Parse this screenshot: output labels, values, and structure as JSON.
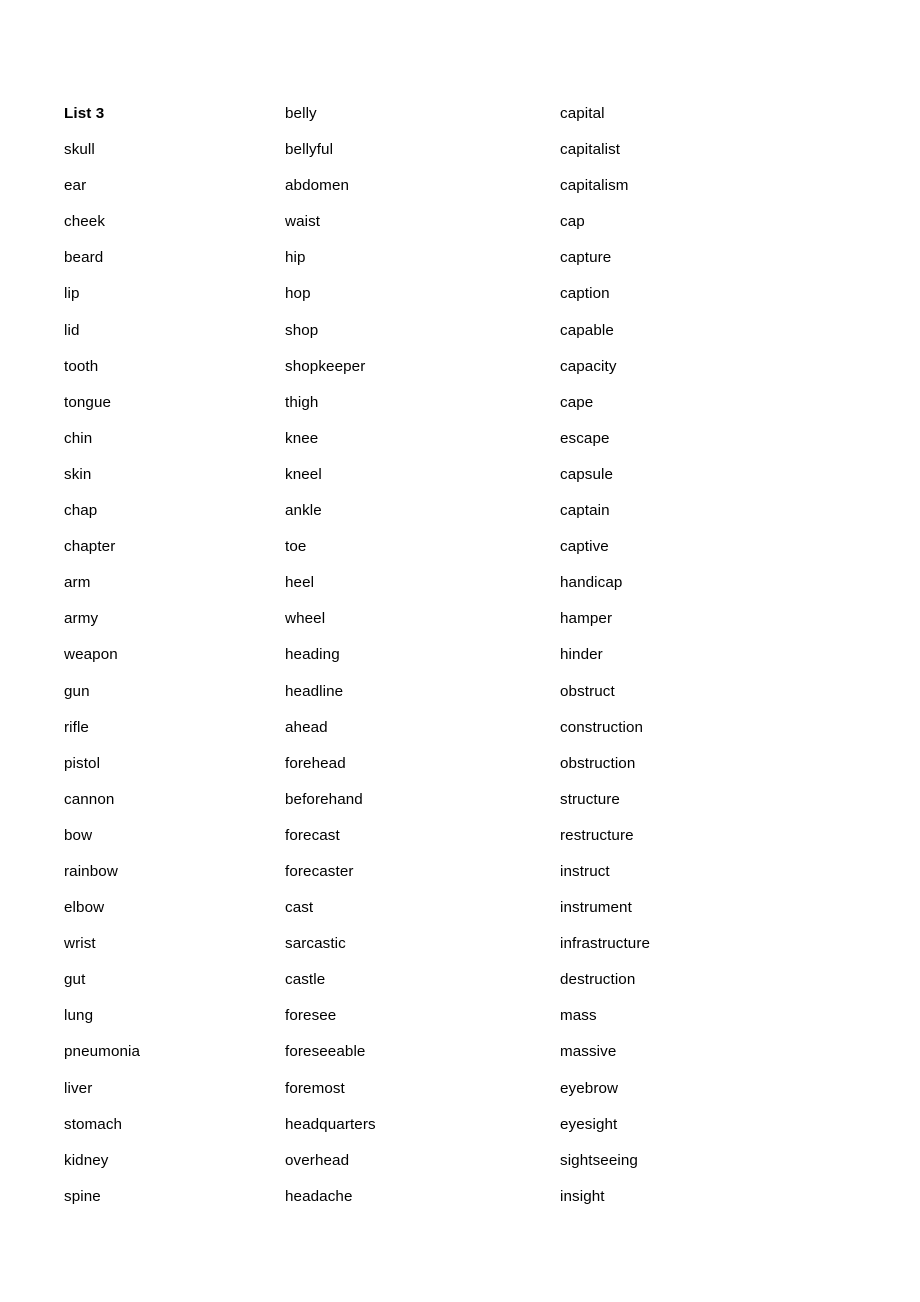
{
  "document": {
    "heading": "List 3",
    "columns": [
      {
        "name": "column-1",
        "words": [
          "skull",
          "ear",
          "cheek",
          "beard",
          "lip",
          "lid",
          "tooth",
          "tongue",
          "chin",
          "skin",
          "chap",
          "chapter",
          "arm",
          "army",
          "weapon",
          "gun",
          "rifle",
          "pistol",
          "cannon",
          "bow",
          "rainbow",
          "elbow",
          "wrist",
          "gut",
          "lung",
          "pneumonia",
          "liver",
          "stomach",
          "kidney",
          "spine"
        ]
      },
      {
        "name": "column-2",
        "words": [
          "belly",
          "bellyful",
          "abdomen",
          "waist",
          "hip",
          "hop",
          "shop",
          "shopkeeper",
          "thigh",
          "knee",
          "kneel",
          "ankle",
          "toe",
          "heel",
          "wheel",
          "heading",
          "headline",
          "ahead",
          "forehead",
          "beforehand",
          "forecast",
          "forecaster",
          "cast",
          "sarcastic",
          "castle",
          "foresee",
          "foreseeable",
          "foremost",
          "headquarters",
          "overhead",
          "headache"
        ]
      },
      {
        "name": "column-3",
        "words": [
          "capital",
          "capitalist",
          "capitalism",
          "cap",
          "capture",
          "caption",
          "capable",
          "capacity",
          "cape",
          "escape",
          "capsule",
          "captain",
          "captive",
          "handicap",
          "hamper",
          "hinder",
          "obstruct",
          "construction",
          "obstruction",
          "structure",
          "restructure",
          "instruct",
          "instrument",
          "infrastructure",
          "destruction",
          "mass",
          "massive",
          "eyebrow",
          "eyesight",
          "sightseeing",
          "insight"
        ]
      }
    ],
    "style": {
      "text_color": "#000000",
      "background_color": "#ffffff"
    }
  }
}
